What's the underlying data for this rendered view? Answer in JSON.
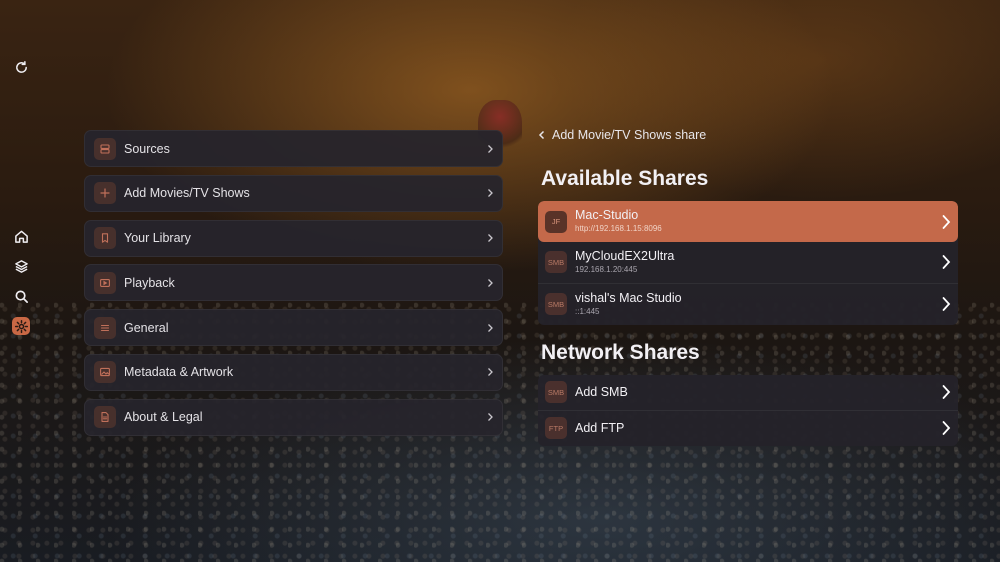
{
  "rail": {
    "items": [
      {
        "name": "refresh-icon"
      },
      {
        "name": "home-icon"
      },
      {
        "name": "layers-icon"
      },
      {
        "name": "search-icon"
      },
      {
        "name": "settings-icon",
        "active": true
      }
    ]
  },
  "menu": {
    "items": [
      {
        "label": "Sources",
        "icon": "server-icon"
      },
      {
        "label": "Add Movies/TV Shows",
        "icon": "plus-icon"
      },
      {
        "label": "Your Library",
        "icon": "bookmark-icon"
      },
      {
        "label": "Playback",
        "icon": "play-icon"
      },
      {
        "label": "General",
        "icon": "list-icon"
      },
      {
        "label": "Metadata & Artwork",
        "icon": "image-icon"
      },
      {
        "label": "About & Legal",
        "icon": "document-icon"
      }
    ]
  },
  "breadcrumb": {
    "label": "Add Movie/TV Shows share"
  },
  "available": {
    "title": "Available Shares",
    "items": [
      {
        "badge": "JF",
        "name": "Mac-Studio",
        "address": "http://192.168.1.15:8096",
        "selected": true
      },
      {
        "badge": "SMB",
        "name": "MyCloudEX2Ultra",
        "address": "192.168.1.20:445"
      },
      {
        "badge": "SMB",
        "name": "vishal's Mac Studio",
        "address": "::1:445"
      }
    ]
  },
  "network": {
    "title": "Network Shares",
    "items": [
      {
        "badge": "SMB",
        "name": "Add SMB"
      },
      {
        "badge": "FTP",
        "name": "Add FTP"
      }
    ]
  },
  "colors": {
    "accent": "#c4694a",
    "icon_bg": "#47302c",
    "card_bg": "#26242c"
  }
}
